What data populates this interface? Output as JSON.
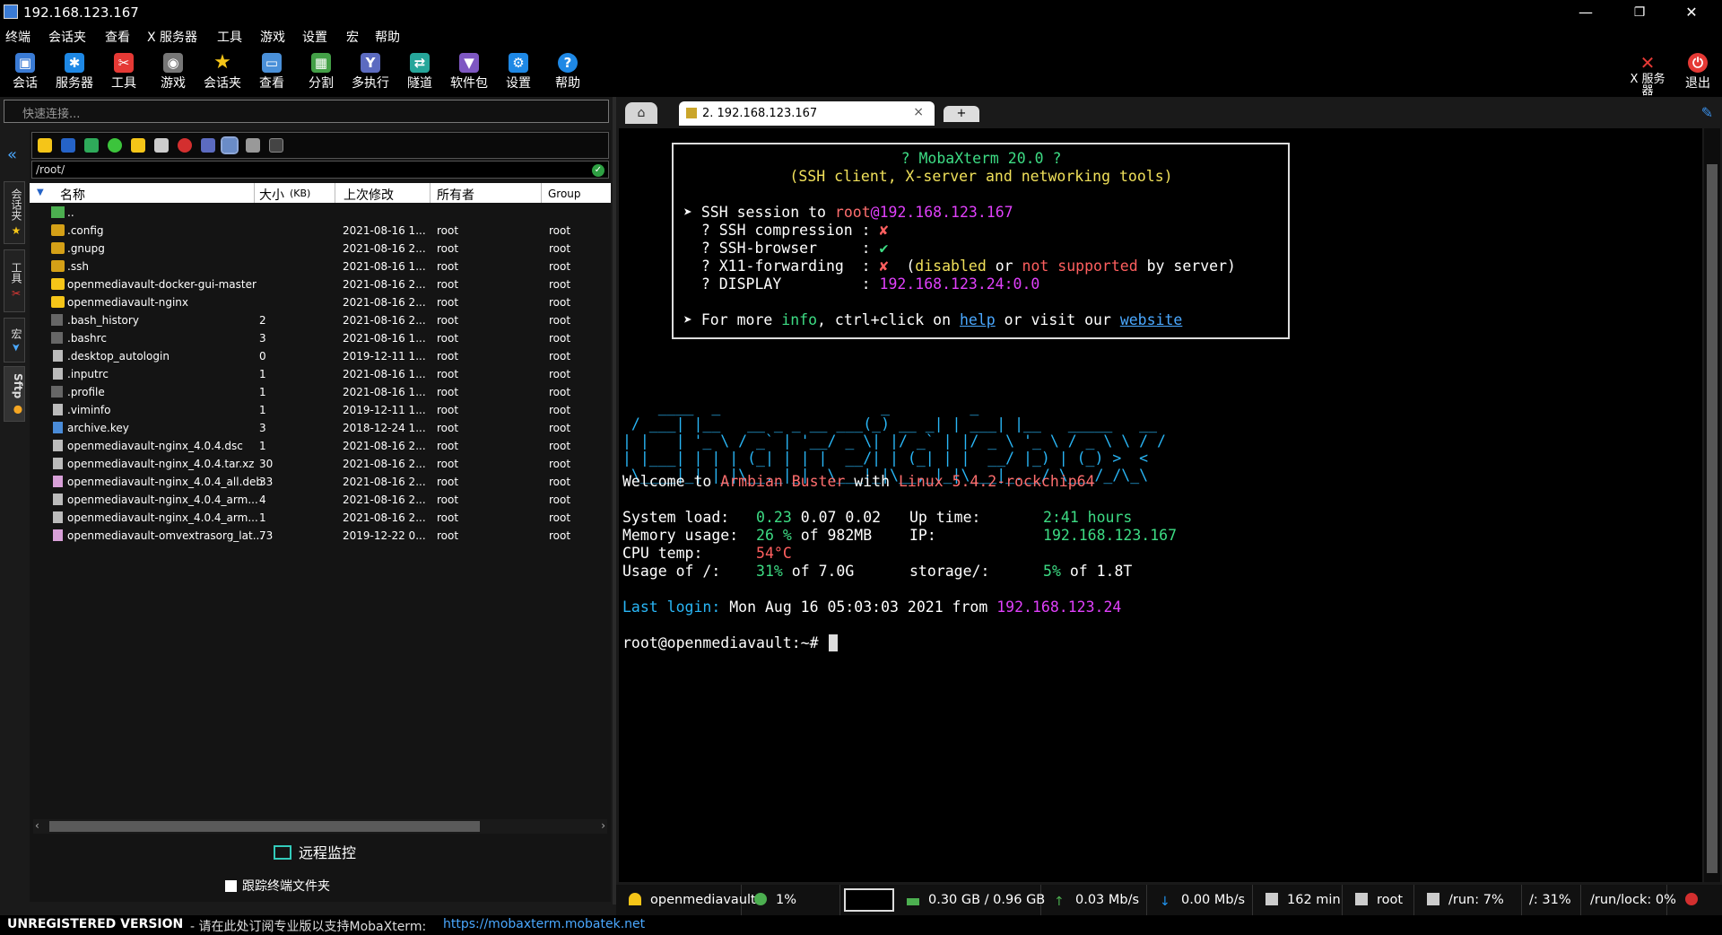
{
  "window": {
    "title": "192.168.123.167",
    "minimize": "—",
    "maximize": "❐",
    "close": "✕"
  },
  "menu": [
    "终端",
    "会话夹",
    "查看",
    "X 服务器",
    "工具",
    "游戏",
    "设置",
    "宏",
    "帮助"
  ],
  "toolbar": [
    {
      "label": "会话",
      "icon": "session-icon",
      "color": "#3a7bd5"
    },
    {
      "label": "服务器",
      "icon": "servers-icon",
      "color": "#1e88e5"
    },
    {
      "label": "工具",
      "icon": "tools-icon",
      "color": "#e53935"
    },
    {
      "label": "游戏",
      "icon": "games-icon",
      "color": "#777777"
    },
    {
      "label": "会话夹",
      "icon": "star-icon",
      "color": "#f5c518"
    },
    {
      "label": "查看",
      "icon": "view-icon",
      "color": "#4a90d9"
    },
    {
      "label": "分割",
      "icon": "split-icon",
      "color": "#43a047"
    },
    {
      "label": "多执行",
      "icon": "multiexec-icon",
      "color": "#5c6bc0"
    },
    {
      "label": "隧道",
      "icon": "tunnel-icon",
      "color": "#26a69a"
    },
    {
      "label": "软件包",
      "icon": "packages-icon",
      "color": "#7e57c2"
    },
    {
      "label": "设置",
      "icon": "settings-icon",
      "color": "#1e88e5"
    },
    {
      "label": "帮助",
      "icon": "help-icon",
      "color": "#1e88e5"
    }
  ],
  "toolbar_right": {
    "xserver": "X 服务器",
    "exit": "退出"
  },
  "quick_connect": {
    "placeholder": "快速连接..."
  },
  "side_tabs": {
    "sessions": "会话夹",
    "tools": "工具",
    "macros": "宏",
    "sftp": "Sftp"
  },
  "sftp": {
    "path": "/root/",
    "columns": {
      "name": "名称",
      "size": "大小",
      "size_unit": "(KB)",
      "modified": "上次修改",
      "owner": "所有者",
      "group": "Group"
    },
    "files": [
      {
        "name": "..",
        "size": "",
        "modified": "",
        "owner": "",
        "group": "",
        "icon": "up"
      },
      {
        "name": ".config",
        "size": "",
        "modified": "2021-08-16 1...",
        "owner": "root",
        "group": "root",
        "icon": "folder"
      },
      {
        "name": ".gnupg",
        "size": "",
        "modified": "2021-08-16 2...",
        "owner": "root",
        "group": "root",
        "icon": "folder"
      },
      {
        "name": ".ssh",
        "size": "",
        "modified": "2021-08-16 1...",
        "owner": "root",
        "group": "root",
        "icon": "folder"
      },
      {
        "name": "openmediavault-docker-gui-master",
        "size": "",
        "modified": "2021-08-16 2...",
        "owner": "root",
        "group": "root",
        "icon": "folder-bright"
      },
      {
        "name": "openmediavault-nginx",
        "size": "",
        "modified": "2021-08-16 2...",
        "owner": "root",
        "group": "root",
        "icon": "folder-bright"
      },
      {
        "name": ".bash_history",
        "size": "2",
        "modified": "2021-08-16 2...",
        "owner": "root",
        "group": "root",
        "icon": "file-dark"
      },
      {
        "name": ".bashrc",
        "size": "3",
        "modified": "2021-08-16 1...",
        "owner": "root",
        "group": "root",
        "icon": "file-dark"
      },
      {
        "name": ".desktop_autologin",
        "size": "0",
        "modified": "2019-12-11 1...",
        "owner": "root",
        "group": "root",
        "icon": "file"
      },
      {
        "name": ".inputrc",
        "size": "1",
        "modified": "2021-08-16 1...",
        "owner": "root",
        "group": "root",
        "icon": "file"
      },
      {
        "name": ".profile",
        "size": "1",
        "modified": "2021-08-16 1...",
        "owner": "root",
        "group": "root",
        "icon": "file-dark"
      },
      {
        "name": ".viminfo",
        "size": "1",
        "modified": "2019-12-11 1...",
        "owner": "root",
        "group": "root",
        "icon": "file"
      },
      {
        "name": "archive.key",
        "size": "3",
        "modified": "2018-12-24 1...",
        "owner": "root",
        "group": "root",
        "icon": "file"
      },
      {
        "name": "openmediavault-nginx_4.0.4.dsc",
        "size": "1",
        "modified": "2021-08-16 2...",
        "owner": "root",
        "group": "root",
        "icon": "file"
      },
      {
        "name": "openmediavault-nginx_4.0.4.tar.xz",
        "size": "30",
        "modified": "2021-08-16 2...",
        "owner": "root",
        "group": "root",
        "icon": "file"
      },
      {
        "name": "openmediavault-nginx_4.0.4_all.deb",
        "size": "33",
        "modified": "2021-08-16 2...",
        "owner": "root",
        "group": "root",
        "icon": "file"
      },
      {
        "name": "openmediavault-nginx_4.0.4_arm...",
        "size": "4",
        "modified": "2021-08-16 2...",
        "owner": "root",
        "group": "root",
        "icon": "file"
      },
      {
        "name": "openmediavault-nginx_4.0.4_arm...",
        "size": "1",
        "modified": "2021-08-16 2...",
        "owner": "root",
        "group": "root",
        "icon": "file"
      },
      {
        "name": "openmediavault-omvextrasorg_lat...",
        "size": "73",
        "modified": "2019-12-22 0...",
        "owner": "root",
        "group": "root",
        "icon": "file"
      }
    ],
    "remote_monitoring": "远程监控",
    "follow_folder": "跟踪终端文件夹"
  },
  "tabs": {
    "home": "⌂",
    "active": "2. 192.168.123.167",
    "close": "×",
    "add": "+"
  },
  "terminal": {
    "box_title": "? MobaXterm 20.0 ?",
    "box_subtitle": "(SSH client, X-server and networking tools)",
    "ssh_prefix": "➤ SSH session to ",
    "ssh_user": "root",
    "ssh_host": "@192.168.123.167",
    "compression_label": "  ? SSH compression : ",
    "compression_val": "✘",
    "browser_label": "  ? SSH-browser     : ",
    "browser_val": "✔",
    "x11_label": "  ? X11-forwarding  : ",
    "x11_val": "✘",
    "x11_note_a": "  (",
    "x11_disabled": "disabled",
    "x11_or": " or ",
    "x11_not": "not supported",
    "x11_by": " by server)",
    "display_label": "  ? DISPLAY         : ",
    "display_val": "192.168.123.24:0.0",
    "more_a": "➤ For more ",
    "more_info": "info",
    "more_b": ", ctrl+click on ",
    "more_help": "help",
    "more_c": " or visit our ",
    "more_website": "website",
    "ascii_art": [
      "    ____  _                  _         _",
      " / ___| |__   __ _ _ __ ___(_) __ _| | ___| |__   _____   __",
      "| |   | '_ \\ / _` | '__/ _ \\| |/ _` | |/ _ \\ '_ \\ / _ \\ \\ / /",
      "| |___| | | | (_| | | |  __/| | (_| | |  __/ |_) | (_) >  <",
      " \\____|_| |_|\\__,_|_|  \\___|_|\\__,_|_|\\___|_.__/ \\___/_/\\_\\"
    ],
    "welcome_a": "Welcome to ",
    "welcome_distro": "Armbian Buster",
    "welcome_b": " with ",
    "welcome_kernel": "Linux 5.4.2-rockchip64",
    "sysload_label": "System load:   ",
    "sysload_a": "0.23",
    "sysload_b": " 0.07 0.02",
    "uptime_label": "Up time:       ",
    "uptime_val": "2:41 hours",
    "mem_label": "Memory usage:  ",
    "mem_a": "26 %",
    "mem_b": " of 982MB",
    "ip_label": "IP:            ",
    "ip_val": "192.168.123.167",
    "cpu_label": "CPU temp:      ",
    "cpu_val": "54°C",
    "usage_label": "Usage of /:    ",
    "usage_a": "31%",
    "usage_b": " of 7.0G",
    "storage_label": "storage/:      ",
    "storage_a": "5%",
    "storage_b": " of 1.8T",
    "last_label": "Last login:",
    "last_b": " Mon Aug 16 05:03:03 2021 from ",
    "last_ip": "192.168.123.24",
    "prompt": "root@openmediavault:~# "
  },
  "status": {
    "host": "openmediavault",
    "cpu": "1%",
    "mem": "0.30 GB / 0.96 GB",
    "up": "0.03 Mb/s",
    "down": "0.00 Mb/s",
    "uptime": "162 min",
    "user": "root",
    "run": "/run: 7%",
    "root": "/: 31%",
    "runlock": "/run/lock: 0%"
  },
  "footer": {
    "unregistered": "UNREGISTERED VERSION",
    "message": " - 请在此处订阅专业版以支持MobaXterm:",
    "link": "https://mobaxterm.mobatek.net"
  }
}
